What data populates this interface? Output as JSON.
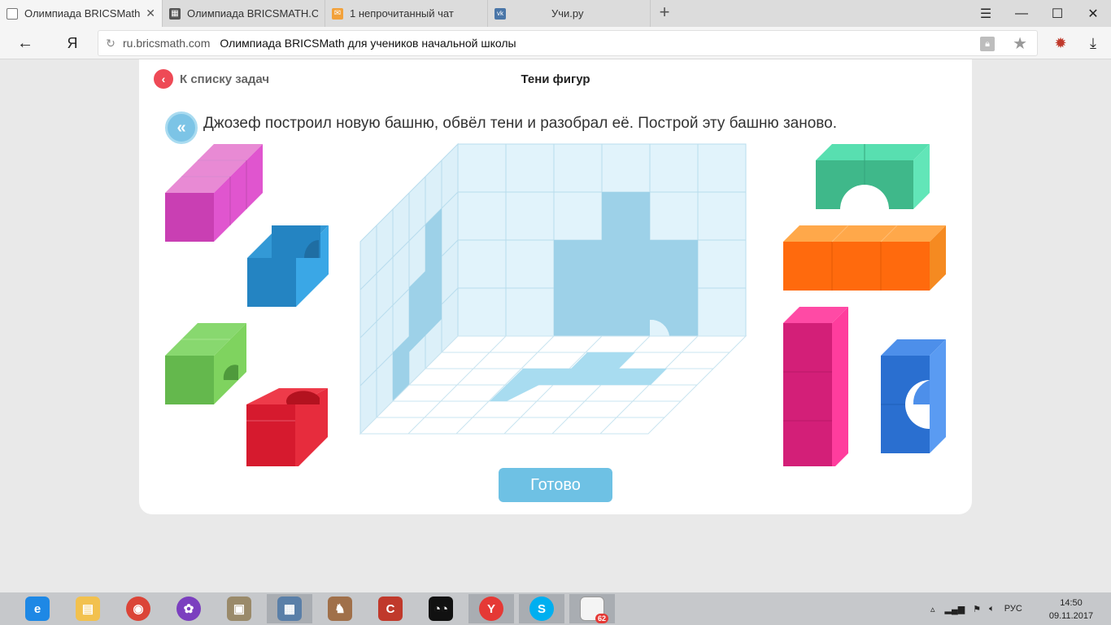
{
  "browser": {
    "tabs": [
      {
        "label": "Олимпиада BRICSMath д",
        "icon": "document-icon",
        "active": true
      },
      {
        "label": "Олимпиада BRICSMATH.CO",
        "icon": "bricsmath-icon",
        "active": false
      },
      {
        "label": "1 непрочитанный чат",
        "icon": "mail-icon",
        "active": false
      },
      {
        "label": "Учи.ру",
        "icon": "vk-icon",
        "active": false
      }
    ],
    "address": {
      "logo": "Я",
      "domain": "ru.bricsmath.com",
      "page_title": "Олимпиада BRICSMath для учеников начальной школы"
    }
  },
  "page": {
    "back_label": "К списку задач",
    "task_title": "Тени фигур",
    "instruction": "Джозеф построил новую башню, обвёл тени и разобрал её. Построй эту башню заново.",
    "done_label": "Готово"
  },
  "pieces": [
    {
      "name": "magenta-piece",
      "color": "#d63fc0"
    },
    {
      "name": "blue-arch-piece",
      "color": "#2486c8"
    },
    {
      "name": "green-arch-piece",
      "color": "#66bb55"
    },
    {
      "name": "red-notch-piece",
      "color": "#dd1f33"
    },
    {
      "name": "teal-arch-piece",
      "color": "#3fb88a"
    },
    {
      "name": "orange-bar-piece",
      "color": "#ff6a0d"
    },
    {
      "name": "pink-column-piece",
      "color": "#d31f78"
    },
    {
      "name": "blue-c-piece",
      "color": "#2a6fd0"
    }
  ],
  "taskbar": {
    "apps": [
      {
        "name": "ie-icon",
        "color": "#1e88e5",
        "glyph": "e"
      },
      {
        "name": "explorer-icon",
        "color": "#f2c14e",
        "glyph": ""
      },
      {
        "name": "chrome-icon",
        "color": "#db4437",
        "glyph": ""
      },
      {
        "name": "picasa-icon",
        "color": "#7b3fbf",
        "glyph": ""
      },
      {
        "name": "scanner-icon",
        "color": "#9a8a6a",
        "glyph": ""
      },
      {
        "name": "calculator-icon",
        "color": "#5a7fa8",
        "glyph": ""
      },
      {
        "name": "rabbit-icon",
        "color": "#a0704a",
        "glyph": ""
      },
      {
        "name": "ccleaner-icon",
        "color": "#c0392b",
        "glyph": ""
      },
      {
        "name": "eyes-app-icon",
        "color": "#111111",
        "glyph": ""
      },
      {
        "name": "yandex-browser-icon",
        "color": "#e53935",
        "glyph": "Y"
      },
      {
        "name": "skype-icon",
        "color": "#00aff0",
        "glyph": "S"
      },
      {
        "name": "notes-icon",
        "color": "#e8e8e8",
        "glyph": ""
      }
    ],
    "notes_badge": "62",
    "lang": "РУС",
    "time": "14:50",
    "date": "09.11.2017"
  }
}
